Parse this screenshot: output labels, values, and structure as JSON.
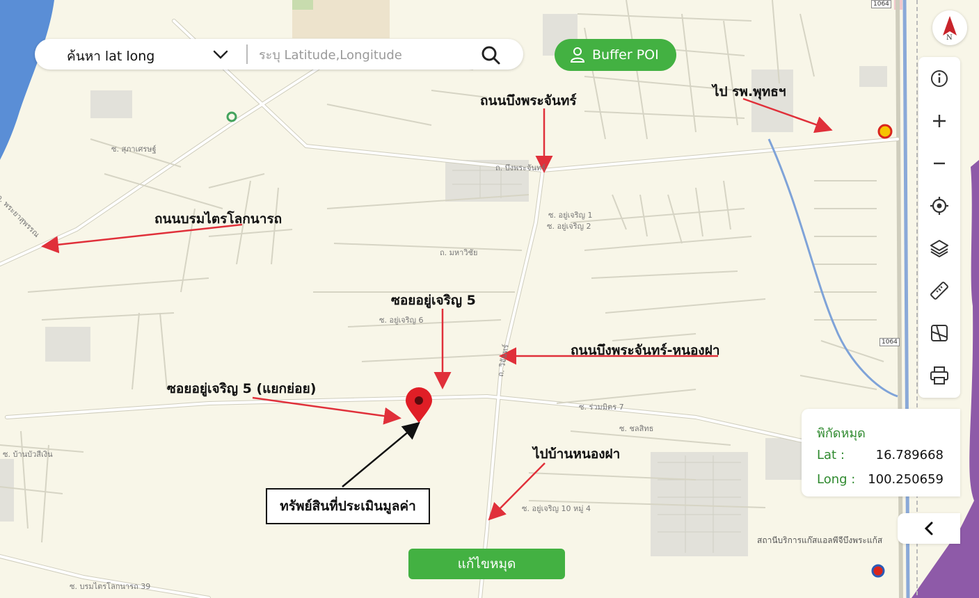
{
  "search": {
    "mode_label": "ค้นหา lat long",
    "placeholder": "ระบุ Latitude,Longitude"
  },
  "buffer_button": {
    "label": "Buffer POI"
  },
  "compass": {
    "label": "N"
  },
  "toolbar": {
    "icons": [
      "info-icon",
      "zoom-in-icon",
      "zoom-out-icon",
      "locate-icon",
      "layers-icon",
      "ruler-icon",
      "map-style-icon",
      "print-icon"
    ]
  },
  "coord_panel": {
    "title": "พิกัดหมุด",
    "lat_label": "Lat :",
    "lat_value": "16.789668",
    "long_label": "Long :",
    "long_value": "100.250659"
  },
  "edit_pin_button": {
    "label": "แก้ไขหมุด"
  },
  "annotations": {
    "road_bueng": "ถนนบึงพระจันทร์",
    "to_hospital": "ไป รพ.พุทธฯ",
    "road_boromtrai": "ถนนบรมไตรโลกนารถ",
    "soi_yucharoen5": "ซอยอยู่เจริญ 5",
    "road_bueng_nongfa": "ถนนบึงพระจันทร์-หนองฝา",
    "soi_yucharoen5_sub": "ซอยอยู่เจริญ 5  (แยกย่อย)",
    "to_ban_nongfa": "ไปบ้านหนองฝา",
    "asset": "ทรัพย์สินที่ประเมินมูลค่า"
  },
  "map_labels": {
    "bueng_road": "ถ. บึงพระจันทร์",
    "mahawichai": "ถ. มหาวิชัย",
    "phraya_suren": "ถ. พระยาสุพรรณ",
    "yucharoen1": "ซ. อยู่เจริญ 1",
    "yucharoen2": "ซ. อยู่เจริญ 2",
    "yucharoen6": "ซ. อยู่เจริญ 6",
    "yucharoen10": "ซ. อยู่เจริญ 10 หมู่ 4",
    "wichan": "ถ. วิจันทร์",
    "ruamit7": "ซ. ร่วมมิตร 7",
    "chonlasit": "ซ. ชลสิทธ",
    "gas_station": "สถานีบริการแก๊สแอลพีจีบึงพระแก้ส",
    "route_1064": "1064",
    "route_1064b": "1064",
    "sukhapiban": "ซ. สุภาเศรษฐ์",
    "bangkrathum": "ซ. บ้านบัวสีเงิน",
    "boromtrai39": "ซ. บรมไตรโลกนารถ 39"
  },
  "colors": {
    "map_bg": "#f8f6e8",
    "road": "#ffffff",
    "road_edge": "#cfcdbd",
    "water": "#5a8ed6",
    "purple_area": "#8e5aa8",
    "accent_green": "#43b142",
    "pin_red": "#e01e26",
    "arrow_red": "#e0303a"
  }
}
